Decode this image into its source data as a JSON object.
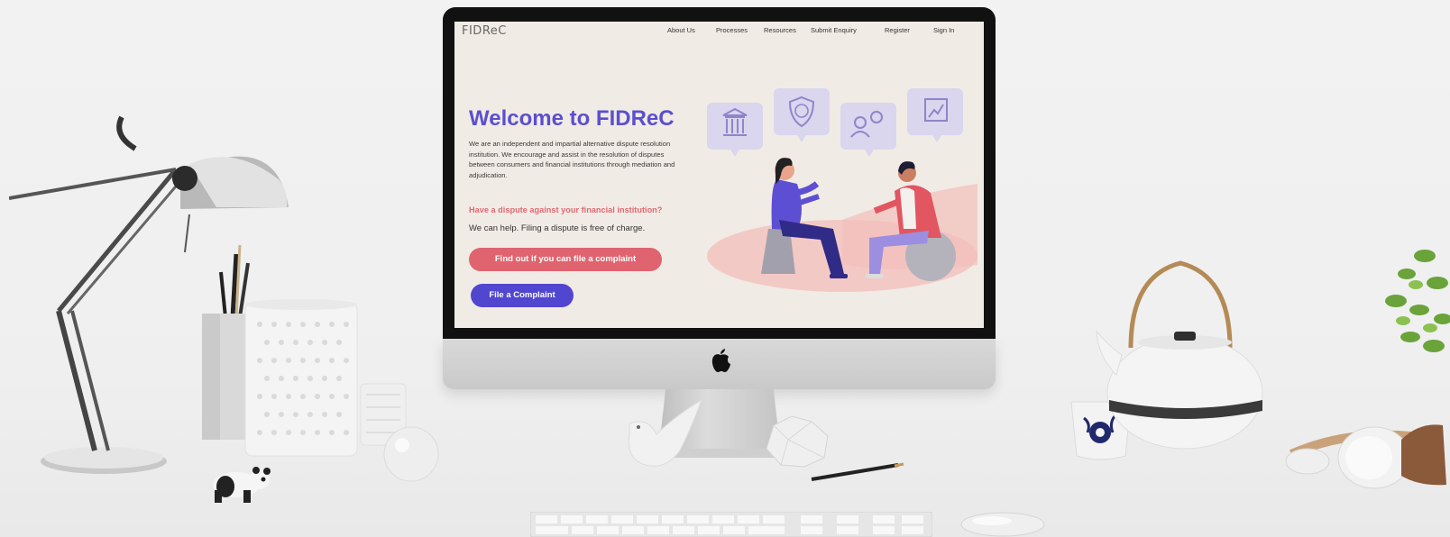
{
  "site": {
    "logo_text": "FIDReC",
    "nav": {
      "about": "About Us",
      "processes": "Processes",
      "resources": "Resources",
      "submit_enquiry": "Submit Enquiry",
      "register": "Register",
      "sign_in": "Sign In"
    },
    "hero": {
      "title": "Welcome to FIDReC",
      "description": "We are an independent and impartial alternative dispute resolution institution. We encourage and assist in the resolution of disputes between consumers and financial institutions through mediation and adjudication.",
      "question": "Have a dispute against your financial institution?",
      "help_text": "We can help. Filing a dispute is free of charge.",
      "primary_button": "Find out if you can file a complaint",
      "secondary_button": "File a Complaint"
    }
  },
  "colors": {
    "brand_purple": "#5b4fd0",
    "brand_pink": "#e0646f",
    "screen_bg": "#f1ebe5",
    "logo_red": "#c9323a"
  },
  "icons": [
    "bank-icon",
    "shield-dollar-icon",
    "users-dollar-icon",
    "chart-up-icon",
    "apple-logo-icon"
  ]
}
